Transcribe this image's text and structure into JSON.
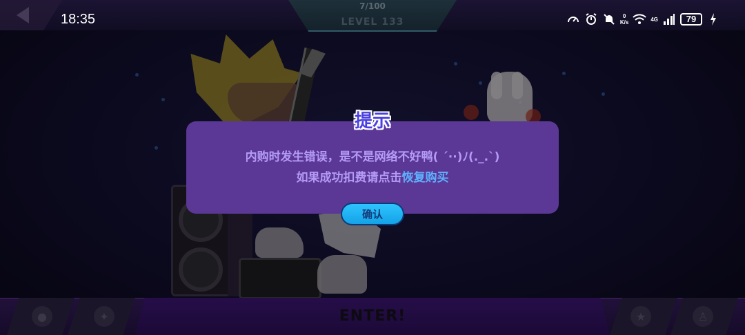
{
  "status_bar": {
    "time": "18:35",
    "net_speed_value": "0",
    "net_speed_unit": "K/s",
    "signal_type": "4G",
    "battery": "79",
    "icons": [
      "speedometer-icon",
      "alarm-icon",
      "mute-icon",
      "wifi-icon",
      "signal-icon",
      "battery-icon",
      "charging-icon"
    ]
  },
  "game": {
    "level_progress": "7/100",
    "level_label": "LEVEL 133",
    "enter_label": "ENTER!"
  },
  "dialog": {
    "title": "提示",
    "message_line1": "内购时发生错误，是不是网络不好鸭( ´··)ﾉ(._.`)",
    "message_line2_prefix": "如果成功扣费请点击",
    "message_line2_link": "恢复购买",
    "confirm_label": "确认"
  },
  "colors": {
    "dialog_bg": "#5b3895",
    "dialog_text": "#b49bf5",
    "link": "#5fb0ff",
    "title": "#4a3fe0",
    "button": "#2ec4ff"
  }
}
